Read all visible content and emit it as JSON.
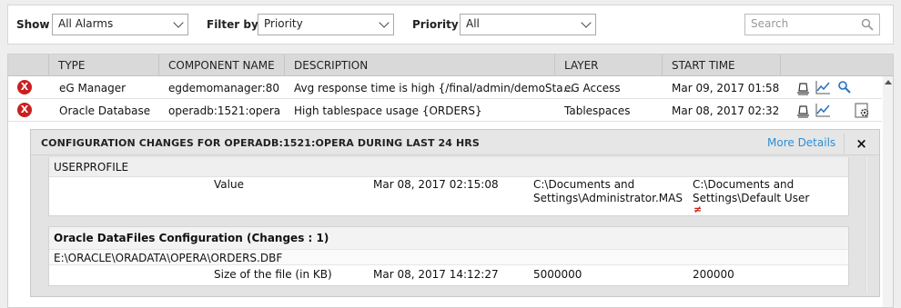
{
  "filters": {
    "show_label": "Show",
    "show_value": "All Alarms",
    "filter_by_label": "Filter by",
    "filter_by_value": "Priority",
    "priority_label": "Priority",
    "priority_value": "All",
    "search_placeholder": "Search"
  },
  "table": {
    "headers": {
      "type": "TYPE",
      "component": "COMPONENT NAME",
      "description": "DESCRIPTION",
      "layer": "LAYER",
      "start_time": "START TIME"
    },
    "rows": [
      {
        "severity": "X",
        "type": "eG Manager",
        "component": "egdemomanager:80",
        "description": "Avg response time is high {/final/admin/demoSta...",
        "layer": "eG Access",
        "start_time": "Mar 09, 2017 01:58"
      },
      {
        "severity": "X",
        "type": "Oracle Database",
        "component": "operadb:1521:opera",
        "description": "High tablespace usage {ORDERS}",
        "layer": "Tablespaces",
        "start_time": "Mar 08, 2017 02:32"
      }
    ]
  },
  "panel": {
    "title": "CONFIGURATION CHANGES FOR OPERADB:1521:OPERA DURING LAST 24 HRS",
    "more_details": "More Details",
    "close": "×",
    "section1": {
      "header": "USERPROFILE",
      "name": "Value",
      "time": "Mar 08, 2017 02:15:08",
      "old_line1": "C:\\Documents and",
      "old_line2": "Settings\\Administrator.MAS",
      "new_line1": "C:\\Documents and",
      "new_line2": "Settings\\Default User",
      "change_mark": "≠"
    },
    "section2": {
      "title": "Oracle DataFiles Configuration  (Changes : 1)",
      "path": "E:\\ORACLE\\ORADATA\\OPERA\\ORDERS.DBF",
      "name": "Size of the file (in KB)",
      "time": "Mar 08, 2017 14:12:27",
      "old": "5000000",
      "new": "200000"
    }
  },
  "colors": {
    "critical": "#c9201f",
    "link": "#2a8fd8"
  }
}
